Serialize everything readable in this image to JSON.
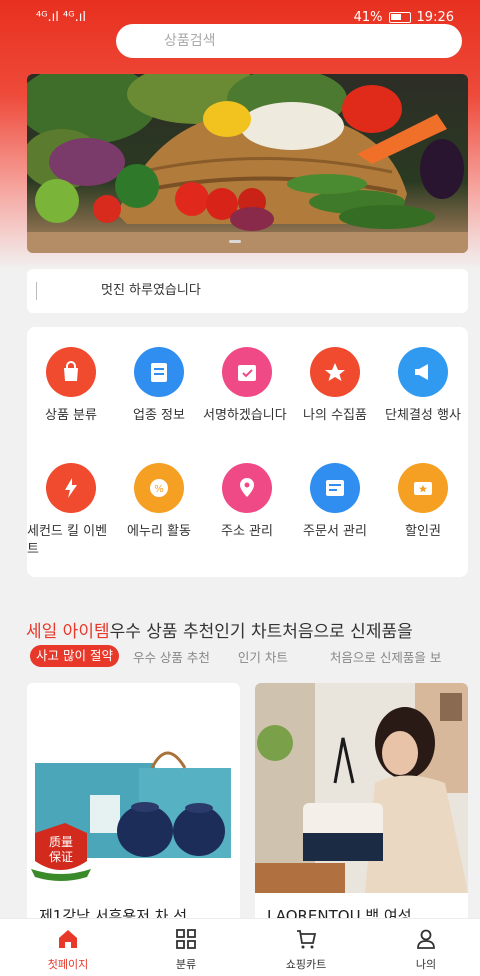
{
  "status": {
    "signal": "⁴ᴳ.ıl ⁴ᴳ.ıl",
    "battery": "41%",
    "time": "19:26"
  },
  "search": {
    "placeholder": "상품검색"
  },
  "notice": {
    "text": "멋진 하루였습니다"
  },
  "categories": [
    {
      "label": "상품 분류",
      "icon": "shopping-bag-icon",
      "color": "#f04a2f"
    },
    {
      "label": "업종 정보",
      "icon": "document-icon",
      "color": "#2f8ef0"
    },
    {
      "label": "서명하겠습니다",
      "icon": "calendar-check-icon",
      "color": "#f04a86"
    },
    {
      "label": "나의 수집품",
      "icon": "star-collection-icon",
      "color": "#f04a2f"
    },
    {
      "label": "단체결성 행사",
      "icon": "megaphone-icon",
      "color": "#2f9af0"
    },
    {
      "label": "세컨드 킬 이벤트",
      "icon": "flash-sale-icon",
      "color": "#f04a2f"
    },
    {
      "label": "에누리 활동",
      "icon": "discount-icon",
      "color": "#f5a023"
    },
    {
      "label": "주소 관리",
      "icon": "location-pin-icon",
      "color": "#f04a86"
    },
    {
      "label": "주문서 관리",
      "icon": "order-list-icon",
      "color": "#2f8ef0"
    },
    {
      "label": "할인권",
      "icon": "coupon-icon",
      "color": "#f5a023"
    }
  ],
  "recommend": {
    "title_red": "세일 아이템",
    "title_rest": "우수 상품 추천인기 차트처음으로 신제품을",
    "tabs": [
      "사고 많이 절약",
      "우수 상품 추천",
      "인기 차트",
      "처음으로 신제품을 보"
    ]
  },
  "products": [
    {
      "name": "제1강남 서후용저 차 선",
      "badge_line1": "质量",
      "badge_line2": "保证"
    },
    {
      "name": "LAORENTOU 백 여성"
    }
  ],
  "tabbar": [
    {
      "label": "첫페이지",
      "icon": "home-icon"
    },
    {
      "label": "분류",
      "icon": "grid-icon"
    },
    {
      "label": "쇼핑카트",
      "icon": "cart-icon"
    },
    {
      "label": "나의",
      "icon": "user-icon"
    }
  ],
  "colors": {
    "brand": "#e8382a"
  }
}
